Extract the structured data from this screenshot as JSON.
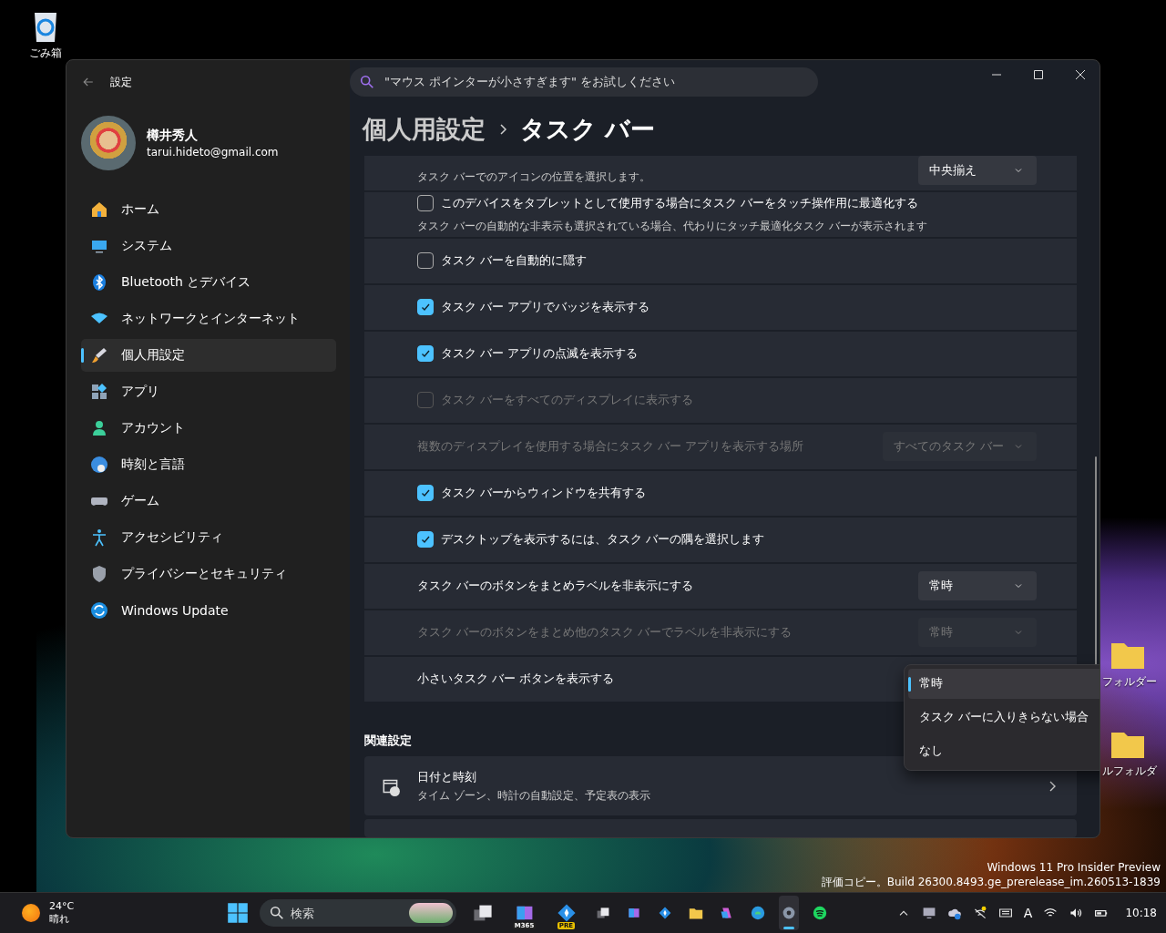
{
  "desktop": {
    "icons": [
      {
        "kind": "recycle-bin",
        "label": "ごみ箱"
      },
      {
        "kind": "folder",
        "label": "フォルダー"
      },
      {
        "kind": "folder",
        "label": "ルフォルダ"
      }
    ],
    "watermark": [
      "Windows 11 Pro Insider Preview",
      "評価コピー。Build 26300.8493.ge_prerelease_im.260513-1839"
    ]
  },
  "window": {
    "title": "設定",
    "search": {
      "placeholder": "\"マウス ポインターが小さすぎます\" をお試しください"
    },
    "user": {
      "name": "樽井秀人",
      "email": "tarui.hideto@gmail.com"
    },
    "sidebar": {
      "items": [
        {
          "label": "ホーム",
          "selected": false
        },
        {
          "label": "システム",
          "selected": false
        },
        {
          "label": "Bluetooth とデバイス",
          "selected": false
        },
        {
          "label": "ネットワークとインターネット",
          "selected": false
        },
        {
          "label": "個人用設定",
          "selected": true
        },
        {
          "label": "アプリ",
          "selected": false
        },
        {
          "label": "アカウント",
          "selected": false
        },
        {
          "label": "時刻と言語",
          "selected": false
        },
        {
          "label": "ゲーム",
          "selected": false
        },
        {
          "label": "アクセシビリティ",
          "selected": false
        },
        {
          "label": "プライバシーとセキュリティ",
          "selected": false
        },
        {
          "label": "Windows Update",
          "selected": false
        }
      ]
    },
    "breadcrumb": {
      "parent": "個人用設定",
      "current": "タスク バー"
    },
    "settings": [
      {
        "kind": "dropdown",
        "description": "タスク バーでのアイコンの位置を選択します。",
        "value": "中央揃え",
        "disabled": false
      },
      {
        "kind": "checkbox",
        "label": "このデバイスをタブレットとして使用する場合にタスク バーをタッチ操作用に最適化する",
        "description": "タスク バーの自動的な非表示も選択されている場合、代わりにタッチ最適化タスク バーが表示されます",
        "checked": false,
        "disabled": false
      },
      {
        "kind": "checkbox",
        "label": "タスク バーを自動的に隠す",
        "checked": false,
        "disabled": false
      },
      {
        "kind": "checkbox",
        "label": "タスク バー アプリでバッジを表示する",
        "checked": true,
        "disabled": false
      },
      {
        "kind": "checkbox",
        "label": "タスク バー アプリの点滅を表示する",
        "checked": true,
        "disabled": false
      },
      {
        "kind": "checkbox",
        "label": "タスク バーをすべてのディスプレイに表示する",
        "checked": false,
        "disabled": true
      },
      {
        "kind": "dropdown",
        "label": "複数のディスプレイを使用する場合にタスク バー アプリを表示する場所",
        "value": "すべてのタスク バー",
        "disabled": true
      },
      {
        "kind": "checkbox",
        "label": "タスク バーからウィンドウを共有する",
        "checked": true,
        "disabled": false
      },
      {
        "kind": "checkbox",
        "label": "デスクトップを表示するには、タスク バーの隅を選択します",
        "checked": true,
        "disabled": false
      },
      {
        "kind": "dropdown",
        "label": "タスク バーのボタンをまとめラベルを非表示にする",
        "value": "常時",
        "disabled": false
      },
      {
        "kind": "dropdown",
        "label": "タスク バーのボタンをまとめ他のタスク バーでラベルを非表示にする",
        "value": "常時",
        "disabled": true
      },
      {
        "kind": "dropdown",
        "label": "小さいタスク バー ボタンを表示する",
        "disabled": false,
        "expanded": true,
        "options": [
          {
            "label": "常時",
            "selected": true
          },
          {
            "label": "タスク バーに入りきらない場合",
            "selected": false
          },
          {
            "label": "なし",
            "selected": false
          }
        ]
      }
    ],
    "related": {
      "heading": "関連設定",
      "items": [
        {
          "title": "日付と時刻",
          "description": "タイム ゾーン、時計の自動設定、予定表の表示"
        }
      ]
    }
  },
  "taskbar": {
    "weather": {
      "temperature": "24°C",
      "condition": "晴れ"
    },
    "search": {
      "placeholder": "検索"
    },
    "apps": [
      {
        "kind": "task-view",
        "active": false
      },
      {
        "kind": "m365",
        "badge": "M365",
        "active": false
      },
      {
        "kind": "pre",
        "badge": "PRE",
        "active": false
      },
      {
        "kind": "task-view",
        "active": false
      },
      {
        "kind": "m365",
        "active": false
      },
      {
        "kind": "pre",
        "active": false
      },
      {
        "kind": "folder",
        "active": false
      },
      {
        "kind": "copilot",
        "active": false
      },
      {
        "kind": "edge",
        "active": false
      },
      {
        "kind": "settings",
        "active": true
      },
      {
        "kind": "spotify",
        "active": false
      }
    ],
    "tray": {
      "ime_mode": "A",
      "time": "10:18"
    }
  }
}
